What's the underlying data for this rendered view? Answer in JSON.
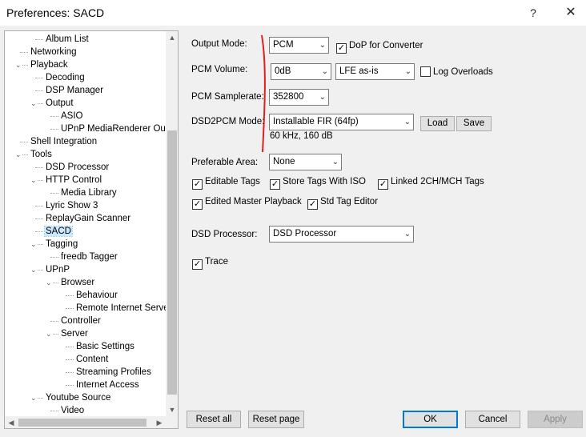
{
  "window": {
    "title": "Preferences: SACD",
    "help_glyph": "?",
    "close_glyph": "✕"
  },
  "tree": {
    "items": [
      {
        "label": "Album List",
        "indent": 2,
        "arrow": ""
      },
      {
        "label": "Networking",
        "indent": 1,
        "arrow": ""
      },
      {
        "label": "Playback",
        "indent": 1,
        "arrow": "v"
      },
      {
        "label": "Decoding",
        "indent": 2,
        "arrow": ""
      },
      {
        "label": "DSP Manager",
        "indent": 2,
        "arrow": ""
      },
      {
        "label": "Output",
        "indent": 2,
        "arrow": "v"
      },
      {
        "label": "ASIO",
        "indent": 3,
        "arrow": ""
      },
      {
        "label": "UPnP MediaRenderer Output",
        "indent": 3,
        "arrow": ""
      },
      {
        "label": "Shell Integration",
        "indent": 1,
        "arrow": ""
      },
      {
        "label": "Tools",
        "indent": 1,
        "arrow": "v"
      },
      {
        "label": "DSD Processor",
        "indent": 2,
        "arrow": ""
      },
      {
        "label": "HTTP Control",
        "indent": 2,
        "arrow": "v"
      },
      {
        "label": "Media Library",
        "indent": 3,
        "arrow": ""
      },
      {
        "label": "Lyric Show 3",
        "indent": 2,
        "arrow": ""
      },
      {
        "label": "ReplayGain Scanner",
        "indent": 2,
        "arrow": ""
      },
      {
        "label": "SACD",
        "indent": 2,
        "arrow": "",
        "selected": true
      },
      {
        "label": "Tagging",
        "indent": 2,
        "arrow": "v"
      },
      {
        "label": "freedb Tagger",
        "indent": 3,
        "arrow": ""
      },
      {
        "label": "UPnP",
        "indent": 2,
        "arrow": "v"
      },
      {
        "label": "Browser",
        "indent": 3,
        "arrow": "v"
      },
      {
        "label": "Behaviour",
        "indent": 4,
        "arrow": ""
      },
      {
        "label": "Remote Internet Servers",
        "indent": 4,
        "arrow": ""
      },
      {
        "label": "Controller",
        "indent": 3,
        "arrow": ""
      },
      {
        "label": "Server",
        "indent": 3,
        "arrow": "v"
      },
      {
        "label": "Basic Settings",
        "indent": 4,
        "arrow": ""
      },
      {
        "label": "Content",
        "indent": 4,
        "arrow": ""
      },
      {
        "label": "Streaming Profiles",
        "indent": 4,
        "arrow": ""
      },
      {
        "label": "Internet Access",
        "indent": 4,
        "arrow": ""
      },
      {
        "label": "Youtube Source",
        "indent": 2,
        "arrow": "v"
      },
      {
        "label": "Video",
        "indent": 3,
        "arrow": ""
      }
    ]
  },
  "settings": {
    "output_mode": {
      "label": "Output Mode:",
      "value": "PCM"
    },
    "dop": {
      "label": "DoP for Converter",
      "checked": true
    },
    "pcm_volume": {
      "label": "PCM Volume:",
      "value": "0dB"
    },
    "lfe": {
      "value": "LFE as-is"
    },
    "log_overloads": {
      "label": "Log Overloads",
      "checked": false
    },
    "pcm_samplerate": {
      "label": "PCM Samplerate:",
      "value": "352800"
    },
    "dsd2pcm": {
      "label": "DSD2PCM Mode:",
      "value": "Installable FIR (64fp)",
      "info": "60 kHz, 160 dB"
    },
    "load_button": "Load",
    "save_button": "Save",
    "preferable_area": {
      "label": "Preferable Area:",
      "value": "None"
    },
    "editable_tags": {
      "label": "Editable Tags",
      "checked": true
    },
    "store_tags_iso": {
      "label": "Store Tags With ISO",
      "checked": true
    },
    "linked_tags": {
      "label": "Linked 2CH/MCH Tags",
      "checked": true
    },
    "edited_master": {
      "label": "Edited Master Playback",
      "checked": true
    },
    "std_tag_editor": {
      "label": "Std Tag Editor",
      "checked": true
    },
    "dsd_processor": {
      "label": "DSD Processor:",
      "value": "DSD Processor"
    },
    "trace": {
      "label": "Trace",
      "checked": true
    }
  },
  "footer": {
    "reset_all": "Reset all",
    "reset_page": "Reset page",
    "ok": "OK",
    "cancel": "Cancel",
    "apply": "Apply"
  },
  "colors": {
    "accent": "#0078d7",
    "selection": "#cce8ff",
    "annotation_red": "#e02020"
  },
  "icons": {
    "check": "✓",
    "dropdown": "chevron-down-icon",
    "scroll_up": "▲",
    "scroll_down": "▼",
    "scroll_left": "◀",
    "scroll_right": "▶"
  }
}
